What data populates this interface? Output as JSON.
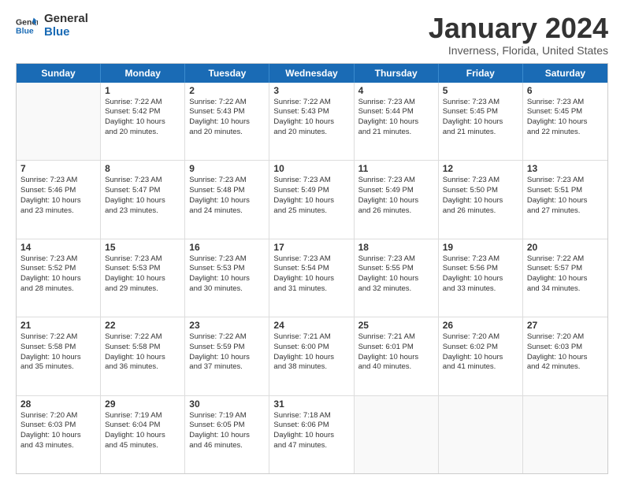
{
  "logo": {
    "line1": "General",
    "line2": "Blue"
  },
  "title": "January 2024",
  "subtitle": "Inverness, Florida, United States",
  "days": [
    "Sunday",
    "Monday",
    "Tuesday",
    "Wednesday",
    "Thursday",
    "Friday",
    "Saturday"
  ],
  "weeks": [
    [
      {
        "day": "",
        "empty": true
      },
      {
        "day": "1",
        "sunrise": "7:22 AM",
        "sunset": "5:42 PM",
        "daylight": "10 hours and 20 minutes."
      },
      {
        "day": "2",
        "sunrise": "7:22 AM",
        "sunset": "5:43 PM",
        "daylight": "10 hours and 20 minutes."
      },
      {
        "day": "3",
        "sunrise": "7:22 AM",
        "sunset": "5:43 PM",
        "daylight": "10 hours and 20 minutes."
      },
      {
        "day": "4",
        "sunrise": "7:23 AM",
        "sunset": "5:44 PM",
        "daylight": "10 hours and 21 minutes."
      },
      {
        "day": "5",
        "sunrise": "7:23 AM",
        "sunset": "5:45 PM",
        "daylight": "10 hours and 21 minutes."
      },
      {
        "day": "6",
        "sunrise": "7:23 AM",
        "sunset": "5:45 PM",
        "daylight": "10 hours and 22 minutes."
      }
    ],
    [
      {
        "day": "7",
        "sunrise": "7:23 AM",
        "sunset": "5:46 PM",
        "daylight": "10 hours and 23 minutes."
      },
      {
        "day": "8",
        "sunrise": "7:23 AM",
        "sunset": "5:47 PM",
        "daylight": "10 hours and 23 minutes."
      },
      {
        "day": "9",
        "sunrise": "7:23 AM",
        "sunset": "5:48 PM",
        "daylight": "10 hours and 24 minutes."
      },
      {
        "day": "10",
        "sunrise": "7:23 AM",
        "sunset": "5:49 PM",
        "daylight": "10 hours and 25 minutes."
      },
      {
        "day": "11",
        "sunrise": "7:23 AM",
        "sunset": "5:49 PM",
        "daylight": "10 hours and 26 minutes."
      },
      {
        "day": "12",
        "sunrise": "7:23 AM",
        "sunset": "5:50 PM",
        "daylight": "10 hours and 26 minutes."
      },
      {
        "day": "13",
        "sunrise": "7:23 AM",
        "sunset": "5:51 PM",
        "daylight": "10 hours and 27 minutes."
      }
    ],
    [
      {
        "day": "14",
        "sunrise": "7:23 AM",
        "sunset": "5:52 PM",
        "daylight": "10 hours and 28 minutes."
      },
      {
        "day": "15",
        "sunrise": "7:23 AM",
        "sunset": "5:53 PM",
        "daylight": "10 hours and 29 minutes."
      },
      {
        "day": "16",
        "sunrise": "7:23 AM",
        "sunset": "5:53 PM",
        "daylight": "10 hours and 30 minutes."
      },
      {
        "day": "17",
        "sunrise": "7:23 AM",
        "sunset": "5:54 PM",
        "daylight": "10 hours and 31 minutes."
      },
      {
        "day": "18",
        "sunrise": "7:23 AM",
        "sunset": "5:55 PM",
        "daylight": "10 hours and 32 minutes."
      },
      {
        "day": "19",
        "sunrise": "7:23 AM",
        "sunset": "5:56 PM",
        "daylight": "10 hours and 33 minutes."
      },
      {
        "day": "20",
        "sunrise": "7:22 AM",
        "sunset": "5:57 PM",
        "daylight": "10 hours and 34 minutes."
      }
    ],
    [
      {
        "day": "21",
        "sunrise": "7:22 AM",
        "sunset": "5:58 PM",
        "daylight": "10 hours and 35 minutes."
      },
      {
        "day": "22",
        "sunrise": "7:22 AM",
        "sunset": "5:58 PM",
        "daylight": "10 hours and 36 minutes."
      },
      {
        "day": "23",
        "sunrise": "7:22 AM",
        "sunset": "5:59 PM",
        "daylight": "10 hours and 37 minutes."
      },
      {
        "day": "24",
        "sunrise": "7:21 AM",
        "sunset": "6:00 PM",
        "daylight": "10 hours and 38 minutes."
      },
      {
        "day": "25",
        "sunrise": "7:21 AM",
        "sunset": "6:01 PM",
        "daylight": "10 hours and 40 minutes."
      },
      {
        "day": "26",
        "sunrise": "7:20 AM",
        "sunset": "6:02 PM",
        "daylight": "10 hours and 41 minutes."
      },
      {
        "day": "27",
        "sunrise": "7:20 AM",
        "sunset": "6:03 PM",
        "daylight": "10 hours and 42 minutes."
      }
    ],
    [
      {
        "day": "28",
        "sunrise": "7:20 AM",
        "sunset": "6:03 PM",
        "daylight": "10 hours and 43 minutes."
      },
      {
        "day": "29",
        "sunrise": "7:19 AM",
        "sunset": "6:04 PM",
        "daylight": "10 hours and 45 minutes."
      },
      {
        "day": "30",
        "sunrise": "7:19 AM",
        "sunset": "6:05 PM",
        "daylight": "10 hours and 46 minutes."
      },
      {
        "day": "31",
        "sunrise": "7:18 AM",
        "sunset": "6:06 PM",
        "daylight": "10 hours and 47 minutes."
      },
      {
        "day": "",
        "empty": true
      },
      {
        "day": "",
        "empty": true
      },
      {
        "day": "",
        "empty": true
      }
    ]
  ],
  "labels": {
    "sunrise": "Sunrise:",
    "sunset": "Sunset:",
    "daylight": "Daylight:"
  }
}
